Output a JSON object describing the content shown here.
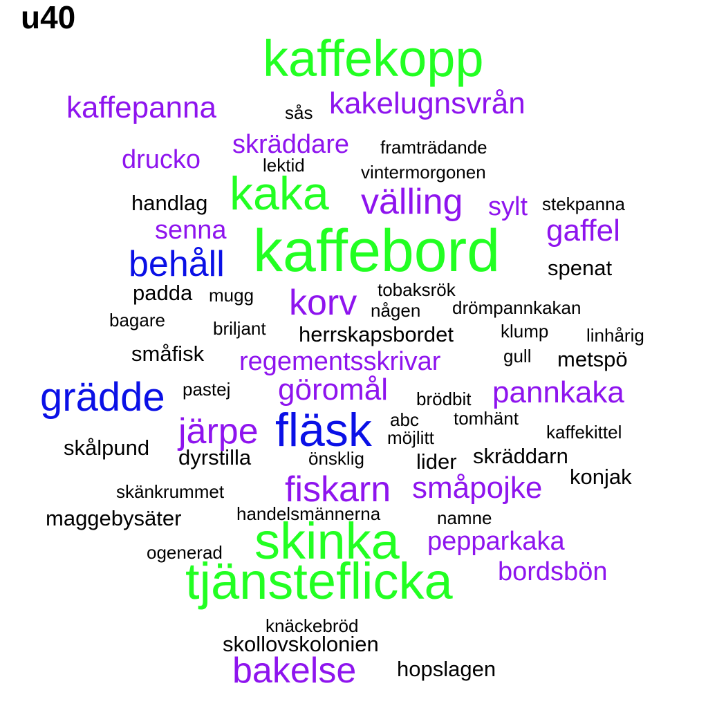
{
  "title": "u40",
  "colors": {
    "green": "#22ff22",
    "purple": "#8e14ee",
    "blue": "#0a10e6",
    "black": "#000000"
  },
  "words": [
    {
      "text": "kaffekopp",
      "color": "green",
      "size": 8
    },
    {
      "text": "kaffepanna",
      "color": "purple",
      "size": 4
    },
    {
      "text": "sås",
      "color": "black",
      "size": 1
    },
    {
      "text": "kakelugnsvrån",
      "color": "purple",
      "size": 4
    },
    {
      "text": "skräddare",
      "color": "purple",
      "size": 3
    },
    {
      "text": "framträdande",
      "color": "black",
      "size": 1
    },
    {
      "text": "drucko",
      "color": "purple",
      "size": 3
    },
    {
      "text": "lektid",
      "color": "black",
      "size": 1
    },
    {
      "text": "vintermorgonen",
      "color": "black",
      "size": 1
    },
    {
      "text": "kaka",
      "color": "green",
      "size": 7
    },
    {
      "text": "handlag",
      "color": "black",
      "size": 2
    },
    {
      "text": "välling",
      "color": "purple",
      "size": 5
    },
    {
      "text": "sylt",
      "color": "purple",
      "size": 3
    },
    {
      "text": "stekpanna",
      "color": "black",
      "size": 1
    },
    {
      "text": "senna",
      "color": "purple",
      "size": 3
    },
    {
      "text": "gaffel",
      "color": "purple",
      "size": 4
    },
    {
      "text": "kaffebord",
      "color": "green",
      "size": 9
    },
    {
      "text": "behåll",
      "color": "blue",
      "size": 5
    },
    {
      "text": "spenat",
      "color": "black",
      "size": 2
    },
    {
      "text": "padda",
      "color": "black",
      "size": 2
    },
    {
      "text": "mugg",
      "color": "black",
      "size": 1
    },
    {
      "text": "tobaksrök",
      "color": "black",
      "size": 1
    },
    {
      "text": "korv",
      "color": "purple",
      "size": 5
    },
    {
      "text": "någen",
      "color": "black",
      "size": 1
    },
    {
      "text": "drömpannkakan",
      "color": "black",
      "size": 1
    },
    {
      "text": "bagare",
      "color": "black",
      "size": 1
    },
    {
      "text": "briljant",
      "color": "black",
      "size": 1
    },
    {
      "text": "herrskapsbordet",
      "color": "black",
      "size": 2
    },
    {
      "text": "klump",
      "color": "black",
      "size": 1
    },
    {
      "text": "linhårig",
      "color": "black",
      "size": 1
    },
    {
      "text": "småfisk",
      "color": "black",
      "size": 2
    },
    {
      "text": "regementsskrivar",
      "color": "purple",
      "size": 3
    },
    {
      "text": "gull",
      "color": "black",
      "size": 1
    },
    {
      "text": "metspö",
      "color": "black",
      "size": 2
    },
    {
      "text": "grädde",
      "color": "blue",
      "size": 6
    },
    {
      "text": "pastej",
      "color": "black",
      "size": 1
    },
    {
      "text": "göromål",
      "color": "purple",
      "size": 4
    },
    {
      "text": "brödbit",
      "color": "black",
      "size": 1
    },
    {
      "text": "pannkaka",
      "color": "purple",
      "size": 4
    },
    {
      "text": "abc",
      "color": "black",
      "size": 1
    },
    {
      "text": "tomhänt",
      "color": "black",
      "size": 1
    },
    {
      "text": "järpe",
      "color": "purple",
      "size": 5
    },
    {
      "text": "fläsk",
      "color": "blue",
      "size": 7
    },
    {
      "text": "möjlitt",
      "color": "black",
      "size": 1
    },
    {
      "text": "kaffekittel",
      "color": "black",
      "size": 1
    },
    {
      "text": "skålpund",
      "color": "black",
      "size": 2
    },
    {
      "text": "dyrstilla",
      "color": "black",
      "size": 2
    },
    {
      "text": "önsklig",
      "color": "black",
      "size": 1
    },
    {
      "text": "lider",
      "color": "black",
      "size": 2
    },
    {
      "text": "skräddarn",
      "color": "black",
      "size": 2
    },
    {
      "text": "konjak",
      "color": "black",
      "size": 2
    },
    {
      "text": "fiskarn",
      "color": "purple",
      "size": 5
    },
    {
      "text": "småpojke",
      "color": "purple",
      "size": 4
    },
    {
      "text": "skänkrummet",
      "color": "black",
      "size": 1
    },
    {
      "text": "handelsmännerna",
      "color": "black",
      "size": 1
    },
    {
      "text": "maggebysäter",
      "color": "black",
      "size": 2
    },
    {
      "text": "namne",
      "color": "black",
      "size": 1
    },
    {
      "text": "skinka",
      "color": "green",
      "size": 8
    },
    {
      "text": "pepparkaka",
      "color": "purple",
      "size": 3
    },
    {
      "text": "ogenerad",
      "color": "black",
      "size": 1
    },
    {
      "text": "bordsbön",
      "color": "purple",
      "size": 3
    },
    {
      "text": "tjänsteflicka",
      "color": "green",
      "size": 8
    },
    {
      "text": "knäckebröd",
      "color": "black",
      "size": 1
    },
    {
      "text": "skollovskolonien",
      "color": "black",
      "size": 2
    },
    {
      "text": "hopslagen",
      "color": "black",
      "size": 2
    },
    {
      "text": "bakelse",
      "color": "purple",
      "size": 5
    }
  ]
}
